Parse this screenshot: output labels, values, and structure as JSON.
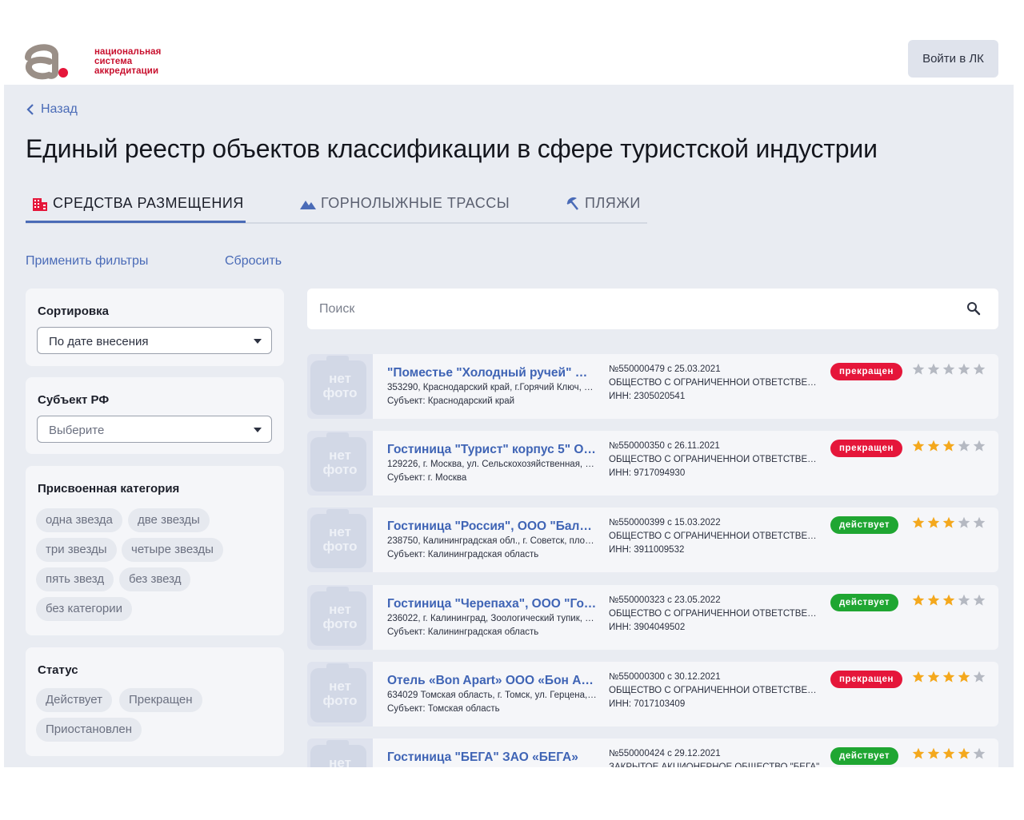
{
  "header": {
    "logo_lines": [
      "национальная",
      "система",
      "аккредитации"
    ],
    "login_label": "Войти в ЛК"
  },
  "nav": {
    "back_label": "Назад"
  },
  "page_title": "Единый реестр объектов классификации в сфере туристской индустрии",
  "tabs": [
    {
      "label": "СРЕДСТВА РАЗМЕЩЕНИЯ",
      "icon": "building-icon",
      "active": true
    },
    {
      "label": "ГОРНОЛЫЖНЫЕ ТРАССЫ",
      "icon": "mountain-icon",
      "active": false
    },
    {
      "label": "ПЛЯЖИ",
      "icon": "beach-umbrella-icon",
      "active": false
    }
  ],
  "filters": {
    "apply_label": "Применить фильтры",
    "reset_label": "Сбросить",
    "sort": {
      "title": "Сортировка",
      "value": "По дате внесения"
    },
    "subject": {
      "title": "Субъект РФ",
      "placeholder": "Выберите"
    },
    "category": {
      "title": "Присвоенная категория",
      "options": [
        "одна звезда",
        "две звезды",
        "три звезды",
        "четыре звезды",
        "пять звезд",
        "без звезд",
        "без категории"
      ]
    },
    "status": {
      "title": "Статус",
      "options": [
        "Действует",
        "Прекращен",
        "Приостановлен"
      ]
    }
  },
  "search": {
    "placeholder": "Поиск"
  },
  "photo_placeholder": [
    "нет",
    "фото"
  ],
  "colors": {
    "accent": "#4a6bb7",
    "stopped": "#e5163a",
    "active": "#1fa632",
    "star_on": "#f4a81d",
    "star_off": "#b5b9c2"
  },
  "results": [
    {
      "name": "\"Поместье \"Холодный ручей\" ОО...",
      "address": "353290, Краснодарский край, г.Горячий Ключ, ул....",
      "subject": "Субъект: Краснодарский край",
      "reg": "№550000479 с 25.03.2021",
      "org": "ОБЩЕСТВО С ОГРАНИЧЕННОЙ ОТВЕТСТВЕНН...",
      "inn": "ИНН: 2305020541",
      "status": "прекращен",
      "status_type": "stopped",
      "stars": 0
    },
    {
      "name": "Гостиница \"Турист\" корпус 5\" ОО...",
      "address": "129226, г. Москва, ул. Сельскохозяйственная, д. 1...",
      "subject": "Субъект: г. Москва",
      "reg": "№550000350 с 26.11.2021",
      "org": "ОБЩЕСТВО С ОГРАНИЧЕННОЙ ОТВЕТСТВЕНН...",
      "inn": "ИНН: 9717094930",
      "status": "прекращен",
      "status_type": "stopped",
      "stars": 3
    },
    {
      "name": "Гостиница \"Россия\", ООО \"Балтик...",
      "address": "238750, Калининградская обл., г. Советск, площад...",
      "subject": "Субъект: Калининградская область",
      "reg": "№550000399 с 15.03.2022",
      "org": "ОБЩЕСТВО С ОГРАНИЧЕННОЙ ОТВЕТСТВЕНН...",
      "inn": "ИНН: 3911009532",
      "status": "действует",
      "status_type": "active",
      "stars": 3
    },
    {
      "name": "Гостиница \"Черепаха\", ООО \"Гости...",
      "address": "236022, г. Калининград, Зоологический тупик, д. 10",
      "subject": "Субъект: Калининградская область",
      "reg": "№550000323 с 23.05.2022",
      "org": "ОБЩЕСТВО С ОГРАНИЧЕННОЙ ОТВЕТСТВЕНН...",
      "inn": "ИНН: 3904049502",
      "status": "действует",
      "status_type": "active",
      "stars": 3
    },
    {
      "name": "Отель «Bon Apart» ООО «Бон Апарт»",
      "address": "634029 Томская область, г. Томск, ул. Герцена, 1-а",
      "subject": "Субъект: Томская область",
      "reg": "№550000300 с 30.12.2021",
      "org": "ОБЩЕСТВО С ОГРАНИЧЕННОЙ ОТВЕТСТВЕНН...",
      "inn": "ИНН: 7017103409",
      "status": "прекращен",
      "status_type": "stopped",
      "stars": 4
    },
    {
      "name": "Гостиница \"БЕГА\" ЗАО «БЕГА»",
      "address": "",
      "subject": "",
      "reg": "№550000424 с 29.12.2021",
      "org": "ЗАКРЫТОЕ АКЦИОНЕРНОЕ ОБЩЕСТВО \"БЕГА\"",
      "inn": "",
      "status": "действует",
      "status_type": "active",
      "stars": 4
    }
  ]
}
